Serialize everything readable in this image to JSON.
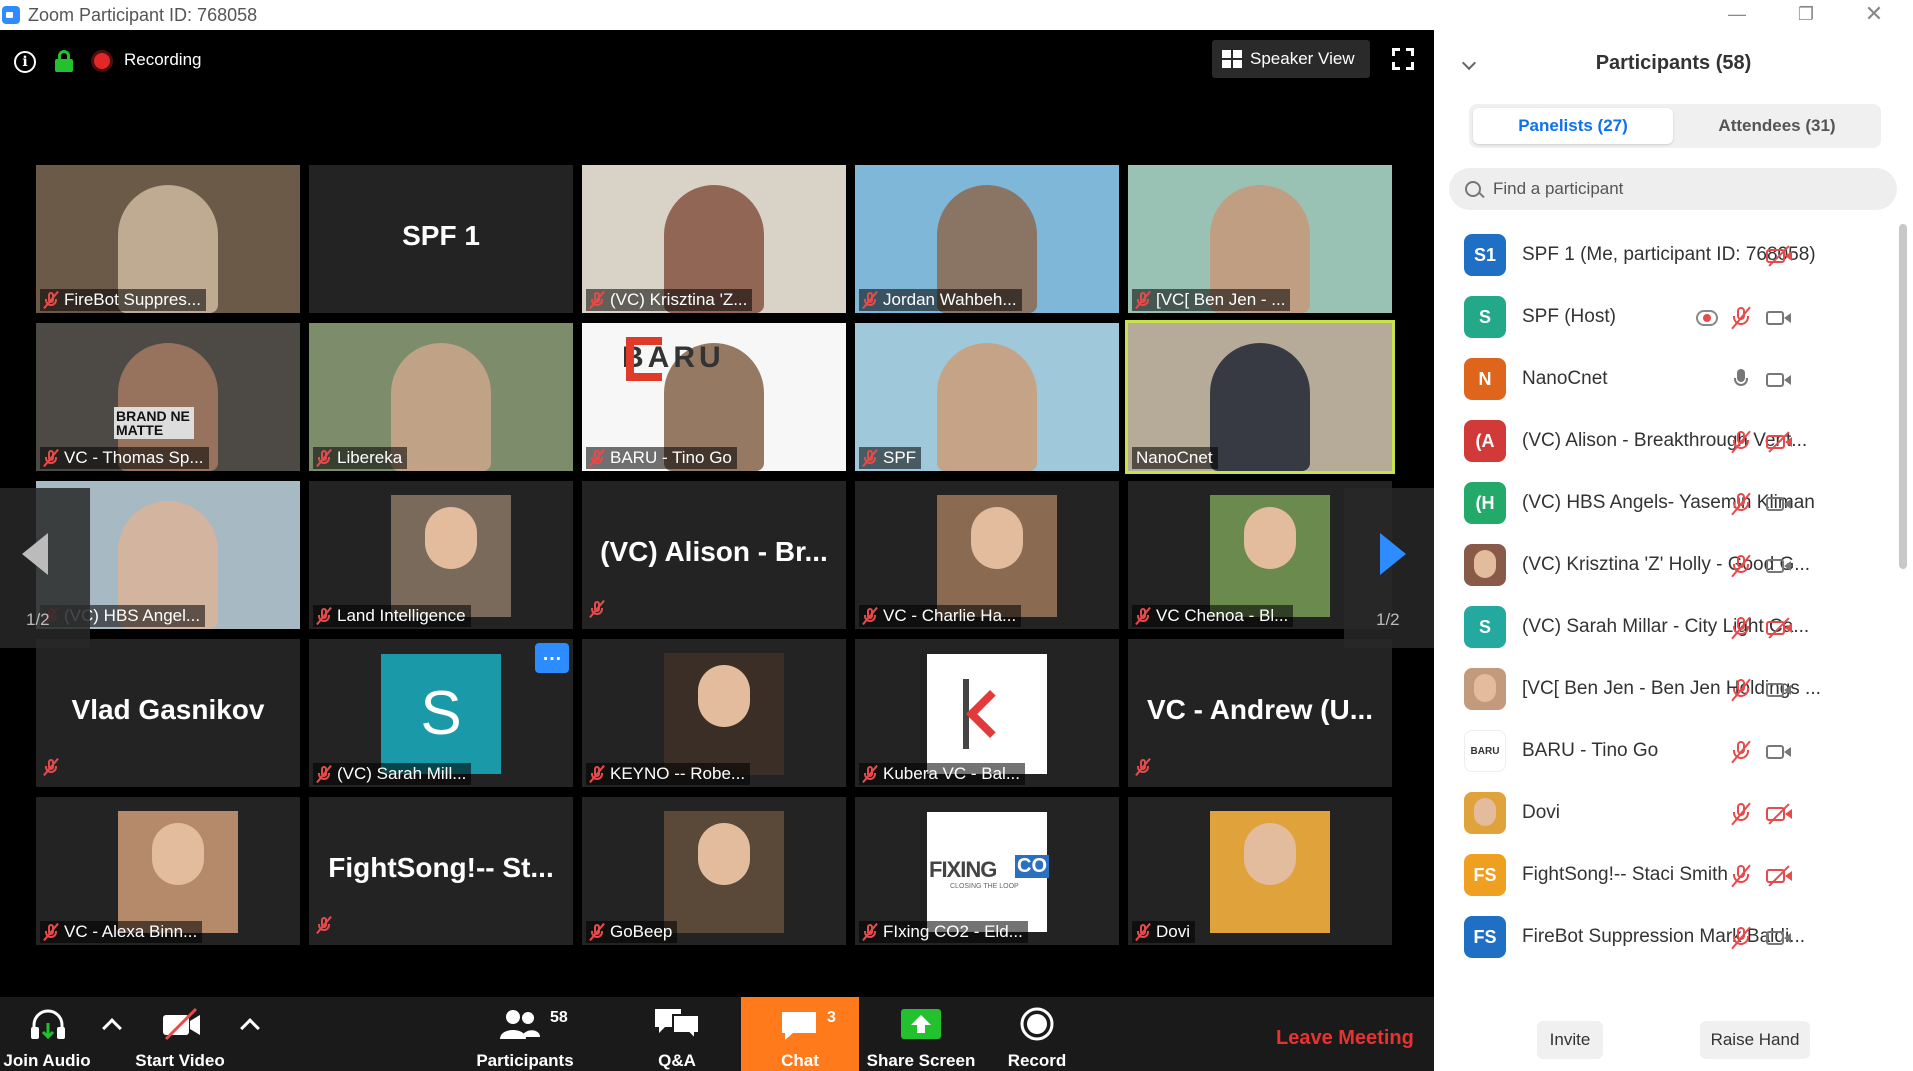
{
  "window": {
    "title": "Zoom Participant ID: 768058"
  },
  "topbar": {
    "recording_label": "Recording",
    "speaker_view_label": "Speaker View"
  },
  "tiles": [
    {
      "name": "FireBot Suppres...",
      "kind": "video",
      "muted": true,
      "bg": "#6b5a48",
      "photo": "#c9b49a"
    },
    {
      "name": "SPF 1",
      "kind": "text",
      "muted": false
    },
    {
      "name": "(VC) Krisztina 'Z...",
      "kind": "video",
      "muted": true,
      "bg": "#d9d2c6",
      "photo": "#8a5a48"
    },
    {
      "name": "Jordan Wahbeh...",
      "kind": "video",
      "muted": true,
      "bg": "#7fb7d8",
      "photo": "#8c6d56"
    },
    {
      "name": "[VC[ Ben Jen - ...",
      "kind": "video",
      "muted": true,
      "bg": "#9ac2b4",
      "photo": "#c49a7c"
    },
    {
      "name": "VC - Thomas Sp...",
      "kind": "video",
      "muted": true,
      "bg": "#4d4a45",
      "photo": "#a07860"
    },
    {
      "name": "Libereka",
      "kind": "video",
      "muted": true,
      "bg": "#7d8c6a",
      "photo": "#c8a48a"
    },
    {
      "name": "BARU - Tino Go",
      "kind": "video",
      "muted": true,
      "bg": "#f7f7f7",
      "photo": "#8a6a52"
    },
    {
      "name": "SPF",
      "kind": "video",
      "muted": true,
      "bg": "#9fc9db",
      "photo": "#c89e7c"
    },
    {
      "name": "NanoCnet",
      "kind": "video",
      "muted": false,
      "bg": "#b6aa98",
      "photo": "#2a2e3a",
      "active": true
    },
    {
      "name": "(VC) HBS Angel...",
      "kind": "video",
      "muted": true,
      "bg": "#a7b9c3",
      "photo": "#d8b49a"
    },
    {
      "name": "Land Intelligence",
      "kind": "pic",
      "muted": true,
      "photo": "#7a6a5c"
    },
    {
      "name": "(VC) Alison - Br...",
      "kind": "text",
      "muted": true
    },
    {
      "name": "VC - Charlie Ha...",
      "kind": "pic",
      "muted": true,
      "photo": "#8a6a50"
    },
    {
      "name": "VC Chenoa - Bl...",
      "kind": "pic",
      "muted": true,
      "photo": "#6b8a4e"
    },
    {
      "name": "Vlad Gasnikov",
      "kind": "text",
      "muted": true
    },
    {
      "name": "(VC) Sarah Mill...",
      "kind": "letter",
      "muted": true,
      "letter": "S"
    },
    {
      "name": "KEYNO -- Robe...",
      "kind": "pic",
      "muted": true,
      "photo": "#3a2e26"
    },
    {
      "name": "Kubera VC - Bal...",
      "kind": "logo-k",
      "muted": true
    },
    {
      "name": "VC - Andrew (U...",
      "kind": "text",
      "muted": true
    },
    {
      "name": "VC - Alexa Binn...",
      "kind": "pic",
      "muted": true,
      "photo": "#b48a6a"
    },
    {
      "name": "FightSong!-- St...",
      "kind": "text",
      "muted": true
    },
    {
      "name": "GoBeep",
      "kind": "pic",
      "muted": true,
      "photo": "#5a4838"
    },
    {
      "name": "FIxing CO2 - Eld...",
      "kind": "logo-fixing",
      "muted": true,
      "logo_text": "FIXING",
      "logo_co": "CO",
      "logo_sub": "CLOSING THE LOOP"
    },
    {
      "name": "Dovi",
      "kind": "pic",
      "muted": true,
      "photo": "#e0a23a"
    }
  ],
  "tile_extras": {
    "baru_logo": "BARU",
    "thomas_sign": "BRAND NE MATTE"
  },
  "pager": {
    "left_label": "1/2",
    "right_label": "1/2"
  },
  "toolbar": {
    "join_audio": "Join Audio",
    "start_video": "Start Video",
    "participants": "Participants",
    "participants_count": "58",
    "qa": "Q&A",
    "chat": "Chat",
    "chat_count": "3",
    "share_screen": "Share Screen",
    "record": "Record",
    "leave": "Leave Meeting"
  },
  "panel": {
    "title": "Participants (58)",
    "tab_panelists": "Panelists (27)",
    "tab_attendees": "Attendees (31)",
    "search_placeholder": "Find a participant",
    "invite": "Invite",
    "raise_hand": "Raise Hand",
    "participants": [
      {
        "initials": "S1",
        "color": "#1f6fc5",
        "name": "SPF 1 (Me, participant ID: 768058)",
        "mic": "none",
        "cam": "off"
      },
      {
        "initials": "S",
        "color": "#23a98a",
        "name": "SPF (Host)",
        "mic": "muted",
        "cam": "on",
        "rec": true
      },
      {
        "initials": "N",
        "color": "#e0651c",
        "name": "NanoCnet",
        "mic": "on",
        "cam": "on"
      },
      {
        "initials": "(A",
        "color": "#d23a3a",
        "name": "(VC) Alison - Breakthrough Vent...",
        "mic": "muted",
        "cam": "off"
      },
      {
        "initials": "(H",
        "color": "#23a96a",
        "name": "(VC) HBS Angels- Yasemin Kliman",
        "mic": "muted",
        "cam": "on"
      },
      {
        "initials": "",
        "color": "#8a5a48",
        "name": "(VC) Krisztina 'Z' Holly - Good G...",
        "mic": "muted",
        "cam": "on",
        "photo": true
      },
      {
        "initials": "S",
        "color": "#23a9a0",
        "name": "(VC) Sarah Millar - City Light Ca...",
        "mic": "muted",
        "cam": "off"
      },
      {
        "initials": "",
        "color": "#c49a7c",
        "name": "[VC[ Ben Jen - Ben Jen Holdings ...",
        "mic": "muted",
        "cam": "on",
        "photo": true
      },
      {
        "initials": "BARU",
        "color": "#ffffff",
        "name": "BARU - Tino Go",
        "mic": "muted",
        "cam": "on",
        "logo": true
      },
      {
        "initials": "",
        "color": "#e0a23a",
        "name": "Dovi",
        "mic": "muted",
        "cam": "off",
        "photo": true
      },
      {
        "initials": "FS",
        "color": "#f0a020",
        "name": "FightSong!-- Staci Smith",
        "mic": "muted",
        "cam": "off"
      },
      {
        "initials": "FS",
        "color": "#1f6fc5",
        "name": "FireBot Suppression Mark Baldi...",
        "mic": "muted",
        "cam": "on"
      }
    ]
  },
  "colors": {
    "accent": "#2d8cff",
    "chat_bg": "#ff7a1a",
    "leave": "#e8322f",
    "active_speaker": "#c8e34a",
    "muted": "#e74a4a"
  }
}
